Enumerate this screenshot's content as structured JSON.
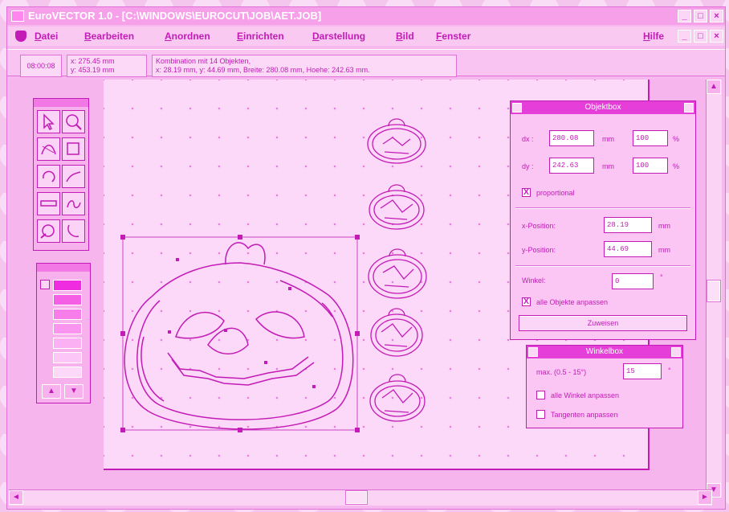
{
  "window": {
    "title": "EuroVECTOR 1.0 - [C:\\WINDOWS\\EUROCUT\\JOB\\AET.JOB]",
    "controls": [
      "minimize",
      "maximize",
      "close"
    ]
  },
  "menu": {
    "items": [
      "Datei",
      "Bearbeiten",
      "Anordnen",
      "Einrichten",
      "Darstellung",
      "Bild",
      "Fenster"
    ],
    "help": "Hilfe"
  },
  "info": {
    "time": "08:00:08",
    "x_label": "x:",
    "x_value": "275.45 mm",
    "y_label": "y:",
    "y_value": "453.19 mm",
    "object_line1": "Kombination mit 14 Objekten,",
    "object_line2": "x: 28.19 mm, y: 44.69 mm, Breite: 280.08 mm, Hoehe: 242.63 mm."
  },
  "colors": {
    "accent": "#c21bb6",
    "titlebar": "#f6a0ea",
    "background": "#f7b5ee",
    "page": "#fcd9f8",
    "swatches": [
      "#f02ce0",
      "#f45fe6",
      "#f77deb",
      "#f994ef",
      "#fab0f2",
      "#fcc6f6",
      "#fdd8f9"
    ]
  },
  "toolbox": {
    "tools": [
      "select-tool",
      "zoom-tool",
      "node-tool",
      "rectangle-tool",
      "rotate-tool",
      "curve-tool",
      "line-tool",
      "text-tool",
      "pen-tool",
      "bezier-tool"
    ]
  },
  "objektbox": {
    "title": "Objektbox",
    "dx_label": "dx :",
    "dx_value": "280.08",
    "dx_unit": "mm",
    "dx_percent": "100",
    "dy_label": "dy :",
    "dy_value": "242.63",
    "dy_unit": "mm",
    "dy_percent": "100",
    "percent_sign": "%",
    "proportional_label": "proportional",
    "x_position_label": "x-Position:",
    "x_position_value": "28.19",
    "y_position_label": "y-Position:",
    "y_position_value": "44.69",
    "position_unit": "mm",
    "winkel_label": "Winkel:",
    "winkel_value": "0",
    "degree_sign": "°",
    "alle_objekte_label": "alle Objekte anpassen",
    "apply_button": "Zuweisen",
    "check_mark": "X"
  },
  "winkelbox": {
    "title": "Winkelbox",
    "max_label": "max. (0.5 - 15°)",
    "max_value": "15",
    "degree_sign": "°",
    "alle_winkel_label": "alle Winkel anpassen",
    "tangenten_label": "Tangenten anpassen"
  }
}
